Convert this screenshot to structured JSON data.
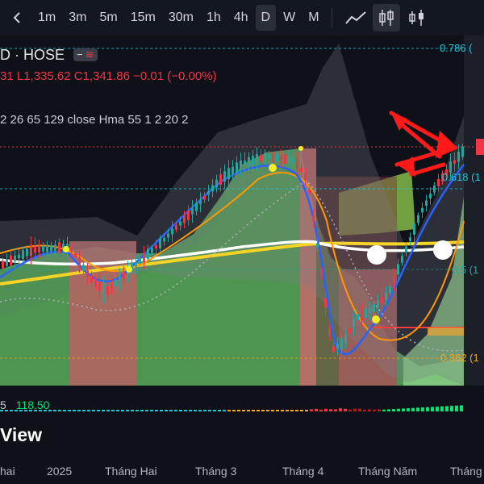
{
  "toolbar": {
    "timeframes": [
      "1m",
      "3m",
      "5m",
      "15m",
      "30m",
      "1h",
      "4h",
      "D",
      "W",
      "M"
    ],
    "active_timeframe": "D"
  },
  "legend": {
    "symbol": "D · HOSE",
    "pill_text": "−",
    "pill_icon": "≋",
    "ohlc_text": "31  L1,335.62  C1,341.86  −0.01 (−0.00%)",
    "indicator_text": "2 26 65 129 close Hma 55 1 2 20 2"
  },
  "fib_labels": {
    "f0786": "0.786 (",
    "f0618": "0.618 (1",
    "f05": "0.5 (1",
    "f0382": "0.382 (1"
  },
  "oscillator": {
    "prefix": "5",
    "value": "118.50"
  },
  "brand_text": "View",
  "x_axis": [
    "hai",
    "2025",
    "Tháng Hai",
    "Tháng 3",
    "Tháng 4",
    "Tháng Năm",
    "Tháng"
  ],
  "colors": {
    "up": "#26a69a",
    "down": "#f23645",
    "fib_teal": "#26c6da",
    "arrow": "#ff1a1a",
    "hma_yellow": "#f5d327"
  }
}
